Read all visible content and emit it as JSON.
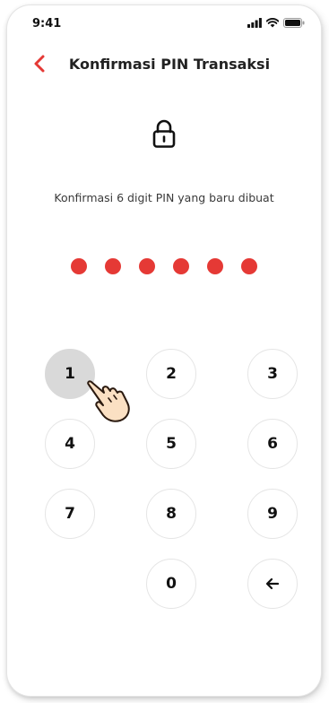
{
  "status_bar": {
    "time": "9:41",
    "icons": [
      "signal-icon",
      "wifi-icon",
      "battery-icon"
    ]
  },
  "header": {
    "title": "Konfirmasi PIN Transaksi",
    "back_icon": "chevron-left-icon"
  },
  "lock_icon": "lock-icon",
  "instruction": "Konfirmasi 6 digit PIN yang baru dibuat",
  "pin": {
    "length": 6,
    "filled": 6
  },
  "keypad": {
    "keys": [
      "1",
      "2",
      "3",
      "4",
      "5",
      "6",
      "7",
      "8",
      "9",
      "0"
    ],
    "pressed_key": "1",
    "backspace_icon": "arrow-left-icon",
    "pointer_icon": "hand-pointer-icon"
  },
  "colors": {
    "accent": "#E53935",
    "pressed_key": "#D9D9D9",
    "text": "#222222"
  }
}
